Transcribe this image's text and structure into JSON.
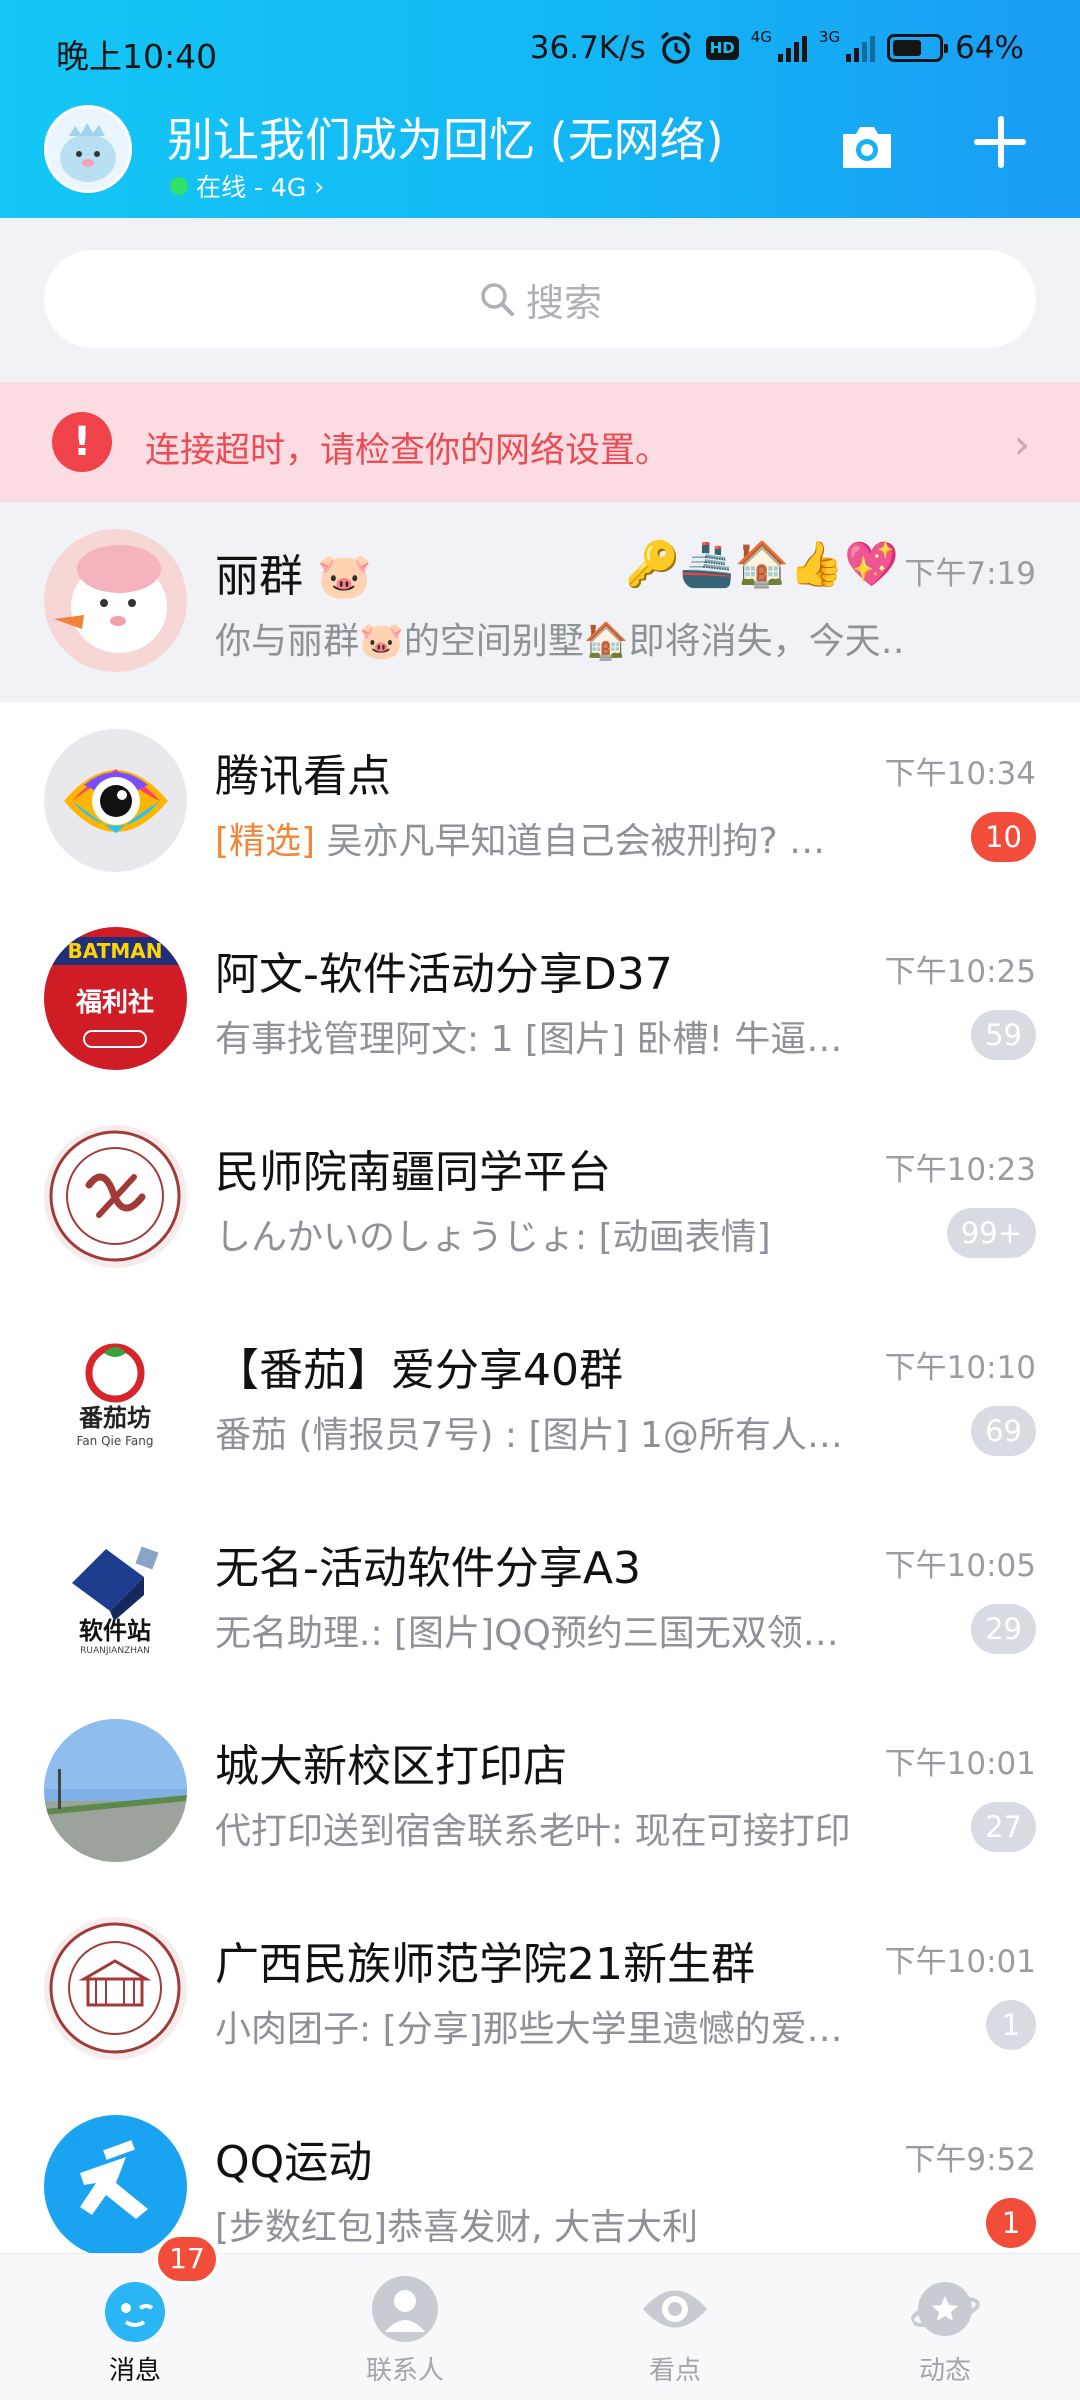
{
  "status_bar": {
    "time": "晚上10:40",
    "speed": "36.7K/s",
    "net1": "4G",
    "net2": "3G",
    "hd": "HD",
    "battery": "64%",
    "battery_level": 0.64
  },
  "header": {
    "title": "别让我们成为回忆 (无网络)",
    "status": "在线 - 4G",
    "status_chevron": "›"
  },
  "search": {
    "placeholder": "搜索"
  },
  "alert": {
    "text": "连接超时，请检查你的网络设置。",
    "chevron": "›"
  },
  "chats": [
    {
      "name": "丽群",
      "name_emoji": "🐷",
      "emoji_row": "🔑🚢🏠👍💖",
      "time": "下午7:19",
      "preview": "你与丽群🐷的空间别墅🏠即将消失，今天…",
      "badge": "",
      "pinned": true,
      "avatar_color": "#f7d6d6"
    },
    {
      "name": "腾讯看点",
      "time": "下午10:34",
      "preview_tag": "[精选]",
      "preview": " 吴亦凡早知道自己会被刑拘? …",
      "badge": "10",
      "badge_style": "red",
      "avatar_color": "#e9e9ed"
    },
    {
      "name": "阿文-软件活动分享D37",
      "time": "下午10:25",
      "preview": "有事找管理阿文: 1 [图片] 卧槽! 牛逼…",
      "badge": "59",
      "badge_style": "grey",
      "avatar_color": "#cf1c25"
    },
    {
      "name": "民师院南疆同学平台",
      "time": "下午10:23",
      "preview": "しんかいのしょうじょ: [动画表情]",
      "badge": "99+",
      "badge_style": "grey",
      "avatar_color": "#f6ecec"
    },
    {
      "name": "【番茄】爱分享40群",
      "time": "下午10:10",
      "preview": "番茄 (情报员7号) : [图片] 1@所有人…",
      "badge": "69",
      "badge_style": "grey",
      "avatar_color": "#ffffff"
    },
    {
      "name": "无名-活动软件分享A3",
      "time": "下午10:05",
      "preview": "无名助理.: [图片]QQ预约三国无双领…",
      "badge": "29",
      "badge_style": "grey",
      "avatar_color": "#ffffff"
    },
    {
      "name": "城大新校区打印店",
      "time": "下午10:01",
      "preview": "代打印送到宿舍联系老叶: 现在可接打印",
      "badge": "27",
      "badge_style": "grey",
      "avatar_color": "#7fb1e6"
    },
    {
      "name": "广西民族师范学院21新生群",
      "time": "下午10:01",
      "preview": "小肉团子: [分享]那些大学里遗憾的爱…",
      "badge": "1",
      "badge_style": "grey",
      "avatar_color": "#f6ecec"
    },
    {
      "name": "QQ运动",
      "time": "下午9:52",
      "preview": "[步数红包]恭喜发财, 大吉大利",
      "badge": "1",
      "badge_style": "red",
      "avatar_color": "#1aa3f0"
    }
  ],
  "avatar_texts": {
    "batman": "BATMAN",
    "fulishe": "福利社",
    "tomato": "番茄坊",
    "tomato_pinyin": "Fan Qie Fang",
    "ruanjian": "软件站",
    "ruanjian_pinyin": "RUANJIANZHAN"
  },
  "nav": {
    "items": [
      {
        "label": "消息",
        "badge": "17",
        "active": true
      },
      {
        "label": "联系人"
      },
      {
        "label": "看点"
      },
      {
        "label": "动态"
      }
    ]
  },
  "colors": {
    "header_start": "#14c7f6",
    "header_end": "#1a9df5",
    "badge_red": "#f24d3a",
    "alert_bg": "#fbdce3",
    "alert_text": "#eb4b52",
    "tag_orange": "#f0883c"
  }
}
